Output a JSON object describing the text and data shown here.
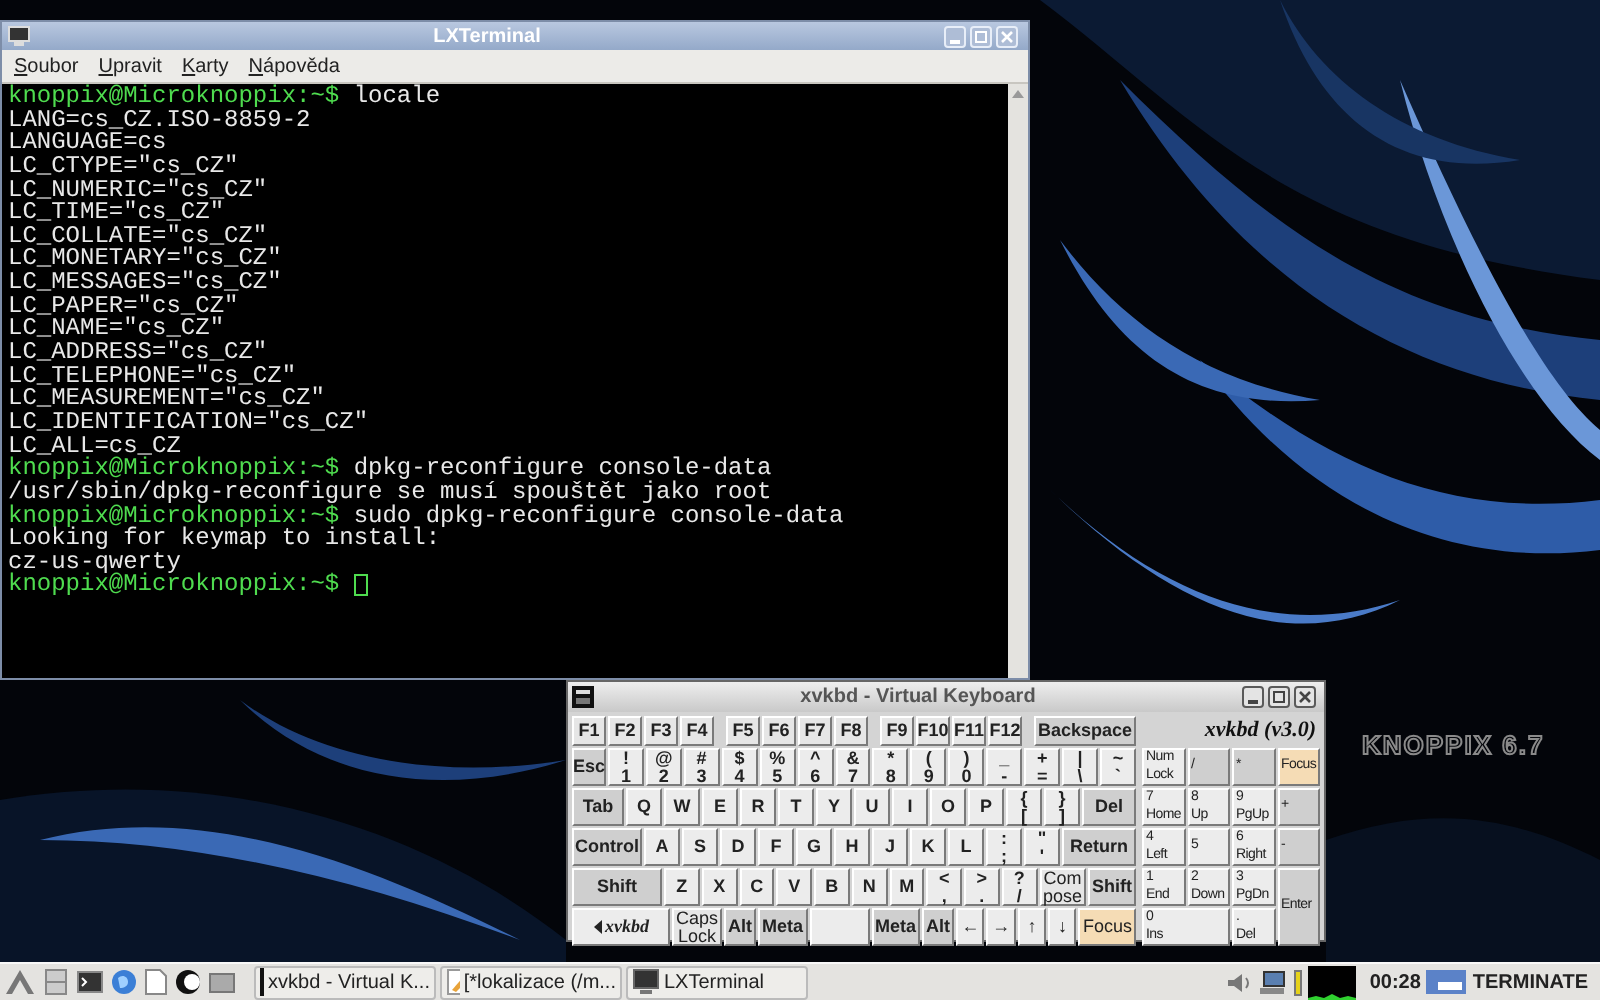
{
  "terminal": {
    "title": "LXTerminal",
    "menu": [
      "Soubor",
      "Upravit",
      "Karty",
      "Nápověda"
    ],
    "lines": [
      {
        "kind": "prompt",
        "prompt": "knoppix@Microknoppix:~$",
        "text": "locale"
      },
      {
        "kind": "output",
        "text": "LANG=cs_CZ.ISO-8859-2"
      },
      {
        "kind": "output",
        "text": "LANGUAGE=cs"
      },
      {
        "kind": "output",
        "text": "LC_CTYPE=\"cs_CZ\""
      },
      {
        "kind": "output",
        "text": "LC_NUMERIC=\"cs_CZ\""
      },
      {
        "kind": "output",
        "text": "LC_TIME=\"cs_CZ\""
      },
      {
        "kind": "output",
        "text": "LC_COLLATE=\"cs_CZ\""
      },
      {
        "kind": "output",
        "text": "LC_MONETARY=\"cs_CZ\""
      },
      {
        "kind": "output",
        "text": "LC_MESSAGES=\"cs_CZ\""
      },
      {
        "kind": "output",
        "text": "LC_PAPER=\"cs_CZ\""
      },
      {
        "kind": "output",
        "text": "LC_NAME=\"cs_CZ\""
      },
      {
        "kind": "output",
        "text": "LC_ADDRESS=\"cs_CZ\""
      },
      {
        "kind": "output",
        "text": "LC_TELEPHONE=\"cs_CZ\""
      },
      {
        "kind": "output",
        "text": "LC_MEASUREMENT=\"cs_CZ\""
      },
      {
        "kind": "output",
        "text": "LC_IDENTIFICATION=\"cs_CZ\""
      },
      {
        "kind": "output",
        "text": "LC_ALL=cs_CZ"
      },
      {
        "kind": "prompt",
        "prompt": "knoppix@Microknoppix:~$",
        "text": "dpkg-reconfigure console-data"
      },
      {
        "kind": "output",
        "text": "/usr/sbin/dpkg-reconfigure se musí spouštět jako root"
      },
      {
        "kind": "prompt",
        "prompt": "knoppix@Microknoppix:~$",
        "text": "sudo dpkg-reconfigure console-data"
      },
      {
        "kind": "output",
        "text": "Looking for keymap to install:"
      },
      {
        "kind": "output",
        "text": "cz-us-qwerty"
      },
      {
        "kind": "prompt",
        "prompt": "knoppix@Microknoppix:~$",
        "cursor": true
      }
    ]
  },
  "keyboard": {
    "title": "xvkbd - Virtual Keyboard",
    "version": "xvkbd (v3.0)",
    "rows": [
      {
        "keys": [
          {
            "kind": "fkey",
            "label": "F1"
          },
          {
            "kind": "fkey",
            "label": "F2"
          },
          {
            "kind": "fkey",
            "label": "F3"
          },
          {
            "kind": "fkey",
            "label": "F4"
          },
          {
            "kind": "fkey",
            "label": "F5"
          },
          {
            "kind": "fkey",
            "label": "F6"
          },
          {
            "kind": "fkey",
            "label": "F7"
          },
          {
            "kind": "fkey",
            "label": "F8"
          },
          {
            "kind": "fkey",
            "label": "F9"
          },
          {
            "kind": "fkey",
            "label": "F10"
          },
          {
            "kind": "fkey",
            "label": "F11"
          },
          {
            "kind": "fkey",
            "label": "F12"
          },
          {
            "kind": "backspace",
            "label": "Backspace"
          }
        ]
      },
      {
        "keys": [
          {
            "kind": "esc",
            "label": "Esc"
          },
          {
            "kind": "key",
            "top": "!",
            "label": "1"
          },
          {
            "kind": "key",
            "top": "@",
            "label": "2"
          },
          {
            "kind": "key",
            "top": "#",
            "label": "3"
          },
          {
            "kind": "key",
            "top": "$",
            "label": "4"
          },
          {
            "kind": "key",
            "top": "%",
            "label": "5"
          },
          {
            "kind": "key",
            "top": "^",
            "label": "6"
          },
          {
            "kind": "key",
            "top": "&",
            "label": "7"
          },
          {
            "kind": "key",
            "top": "*",
            "label": "8"
          },
          {
            "kind": "key",
            "top": "(",
            "label": "9"
          },
          {
            "kind": "key",
            "top": ")",
            "label": "0"
          },
          {
            "kind": "key",
            "top": "_",
            "label": "-"
          },
          {
            "kind": "key",
            "top": "+",
            "label": "="
          },
          {
            "kind": "key",
            "top": "|",
            "label": "\\"
          },
          {
            "kind": "key",
            "top": "~",
            "label": "`"
          }
        ]
      },
      {
        "keys": [
          {
            "kind": "tab",
            "label": "Tab"
          },
          {
            "kind": "key",
            "label": "Q"
          },
          {
            "kind": "key",
            "label": "W"
          },
          {
            "kind": "key",
            "label": "E"
          },
          {
            "kind": "key",
            "label": "R"
          },
          {
            "kind": "key",
            "label": "T"
          },
          {
            "kind": "key",
            "label": "Y"
          },
          {
            "kind": "key",
            "label": "U"
          },
          {
            "kind": "key",
            "label": "I"
          },
          {
            "kind": "key",
            "label": "O"
          },
          {
            "kind": "key",
            "label": "P"
          },
          {
            "kind": "key",
            "top": "{",
            "label": "["
          },
          {
            "kind": "key",
            "top": "}",
            "label": "]"
          },
          {
            "kind": "del",
            "label": "Del"
          }
        ]
      },
      {
        "keys": [
          {
            "kind": "control",
            "label": "Control"
          },
          {
            "kind": "key",
            "label": "A"
          },
          {
            "kind": "key",
            "label": "S"
          },
          {
            "kind": "key",
            "label": "D"
          },
          {
            "kind": "key",
            "label": "F"
          },
          {
            "kind": "key",
            "label": "G"
          },
          {
            "kind": "key",
            "label": "H"
          },
          {
            "kind": "key",
            "label": "J"
          },
          {
            "kind": "key",
            "label": "K"
          },
          {
            "kind": "key",
            "label": "L"
          },
          {
            "kind": "key",
            "top": ":",
            "label": ";"
          },
          {
            "kind": "key",
            "top": "\"",
            "label": "'"
          },
          {
            "kind": "return",
            "label": "Return"
          }
        ]
      },
      {
        "keys": [
          {
            "kind": "shift",
            "label": "Shift"
          },
          {
            "kind": "key",
            "label": "Z"
          },
          {
            "kind": "key",
            "label": "X"
          },
          {
            "kind": "key",
            "label": "C"
          },
          {
            "kind": "key",
            "label": "V"
          },
          {
            "kind": "key",
            "label": "B"
          },
          {
            "kind": "key",
            "label": "N"
          },
          {
            "kind": "key",
            "label": "M"
          },
          {
            "kind": "key",
            "top": "<",
            "label": ","
          },
          {
            "kind": "key",
            "top": ">",
            "label": "."
          },
          {
            "kind": "key",
            "top": "?",
            "label": "/"
          },
          {
            "kind": "small",
            "label": "Com pose"
          },
          {
            "kind": "shift_r",
            "label": "Shift"
          }
        ]
      },
      {
        "keys": [
          {
            "kind": "logo",
            "label": "xvkbd"
          },
          {
            "kind": "small",
            "label": "Caps Lock"
          },
          {
            "kind": "mod",
            "label": "Alt"
          },
          {
            "kind": "mod",
            "label": "Meta"
          },
          {
            "kind": "space"
          },
          {
            "kind": "mod",
            "label": "Meta"
          },
          {
            "kind": "mod",
            "label": "Alt"
          },
          {
            "kind": "key",
            "label": "←"
          },
          {
            "kind": "key",
            "label": "→"
          },
          {
            "kind": "key",
            "label": "↑"
          },
          {
            "kind": "key",
            "label": "↓"
          },
          {
            "kind": "focus",
            "label": "Focus"
          }
        ]
      }
    ],
    "keypad": [
      {
        "kind": "numlock",
        "label": "Num Lock"
      },
      {
        "kind": "mod",
        "label": "/"
      },
      {
        "kind": "mod",
        "label": "*"
      },
      {
        "kind": "focus",
        "label": "Focus"
      },
      {
        "kind": "key",
        "label": "7",
        "sub": "Home"
      },
      {
        "kind": "key",
        "label": "8",
        "sub": "Up"
      },
      {
        "kind": "key",
        "label": "9",
        "sub": "PgUp"
      },
      {
        "kind": "mod",
        "label": "+"
      },
      {
        "kind": "key",
        "label": "4",
        "sub": "Left"
      },
      {
        "kind": "key",
        "label": "5"
      },
      {
        "kind": "key",
        "label": "6",
        "sub": "Right"
      },
      {
        "kind": "mod",
        "label": "-"
      },
      {
        "kind": "key",
        "label": "1",
        "sub": "End"
      },
      {
        "kind": "key",
        "label": "2",
        "sub": "Down"
      },
      {
        "kind": "key",
        "label": "3",
        "sub": "PgDn"
      },
      {
        "kind": "enter",
        "label": "Enter"
      },
      {
        "kind": "zero",
        "label": "0",
        "sub": "Ins"
      },
      {
        "kind": "key",
        "label": ".",
        "sub": "Del"
      }
    ]
  },
  "desktop": {
    "logo": "KNOPPIX 6.7"
  },
  "taskbar": {
    "tasks": [
      {
        "kind": "keyboard",
        "label": "xvkbd - Virtual K..."
      },
      {
        "kind": "editor",
        "label": "[*lokalizace (/m..."
      },
      {
        "kind": "terminal",
        "label": "LXTerminal"
      }
    ],
    "clock": "00:28",
    "terminate": "TERMINATE"
  }
}
